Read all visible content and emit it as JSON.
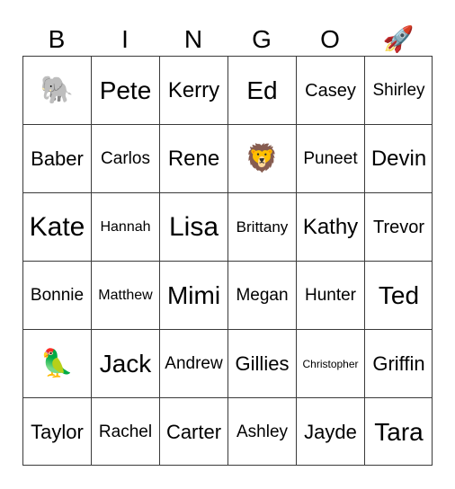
{
  "header": {
    "letters": [
      "B",
      "I",
      "N",
      "G",
      "O"
    ],
    "extra_icon": "rocket-icon",
    "extra_glyph": "🚀"
  },
  "board": {
    "rows": [
      [
        {
          "type": "icon",
          "icon": "elephant-icon",
          "glyph": "🐘"
        },
        {
          "type": "text",
          "text": "Pete"
        },
        {
          "type": "text",
          "text": "Kerry"
        },
        {
          "type": "text",
          "text": "Ed"
        },
        {
          "type": "text",
          "text": "Casey"
        },
        {
          "type": "text",
          "text": "Shirley"
        }
      ],
      [
        {
          "type": "text",
          "text": "Baber"
        },
        {
          "type": "text",
          "text": "Carlos"
        },
        {
          "type": "text",
          "text": "Rene"
        },
        {
          "type": "icon",
          "icon": "lion-icon",
          "glyph": "🦁"
        },
        {
          "type": "text",
          "text": "Puneet"
        },
        {
          "type": "text",
          "text": "Devin"
        }
      ],
      [
        {
          "type": "text",
          "text": "Kate"
        },
        {
          "type": "text",
          "text": "Hannah"
        },
        {
          "type": "text",
          "text": "Lisa"
        },
        {
          "type": "text",
          "text": "Brittany"
        },
        {
          "type": "text",
          "text": "Kathy"
        },
        {
          "type": "text",
          "text": "Trevor"
        }
      ],
      [
        {
          "type": "text",
          "text": "Bonnie"
        },
        {
          "type": "text",
          "text": "Matthew"
        },
        {
          "type": "text",
          "text": "Mimi"
        },
        {
          "type": "text",
          "text": "Megan"
        },
        {
          "type": "text",
          "text": "Hunter"
        },
        {
          "type": "text",
          "text": "Ted"
        }
      ],
      [
        {
          "type": "icon",
          "icon": "parrot-icon",
          "glyph": "🦜"
        },
        {
          "type": "text",
          "text": "Jack"
        },
        {
          "type": "text",
          "text": "Andrew"
        },
        {
          "type": "text",
          "text": "Gillies"
        },
        {
          "type": "text",
          "text": "Christopher"
        },
        {
          "type": "text",
          "text": "Griffin"
        }
      ],
      [
        {
          "type": "text",
          "text": "Taylor"
        },
        {
          "type": "text",
          "text": "Rachel"
        },
        {
          "type": "text",
          "text": "Carter"
        },
        {
          "type": "text",
          "text": "Ashley"
        },
        {
          "type": "text",
          "text": "Jayde"
        },
        {
          "type": "text",
          "text": "Tara"
        }
      ]
    ]
  }
}
